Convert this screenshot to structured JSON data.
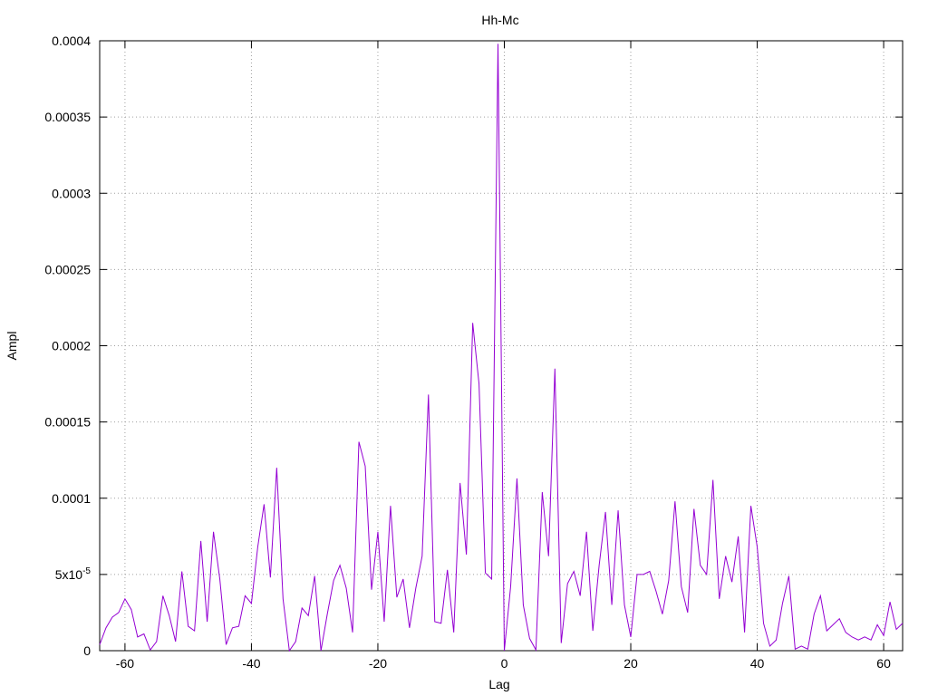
{
  "chart_data": {
    "type": "line",
    "title": "Hh-Mc",
    "xlabel": "Lag",
    "ylabel": "Ampl",
    "xlim": [
      -64,
      63
    ],
    "ylim": [
      0,
      0.0004
    ],
    "grid": true,
    "x_ticks": [
      -60,
      -40,
      -20,
      0,
      20,
      40,
      60
    ],
    "x_tick_labels": [
      "-60",
      "-40",
      "-20",
      "0",
      "20",
      "40",
      "60"
    ],
    "y_ticks": [
      0,
      5e-05,
      0.0001,
      0.00015,
      0.0002,
      0.00025,
      0.0003,
      0.00035,
      0.0004
    ],
    "y_tick_labels": [
      "0",
      "5x10-5",
      "0.0001",
      "0.00015",
      "0.0002",
      "0.00025",
      "0.0003",
      "0.00035",
      "0.0004"
    ],
    "series": [
      {
        "color": "#9400d3",
        "x": [
          -64,
          -63,
          -62,
          -61,
          -60,
          -59,
          -58,
          -57,
          -56,
          -55,
          -54,
          -53,
          -52,
          -51,
          -50,
          -49,
          -48,
          -47,
          -46,
          -45,
          -44,
          -43,
          -42,
          -41,
          -40,
          -39,
          -38,
          -37,
          -36,
          -35,
          -34,
          -33,
          -32,
          -31,
          -30,
          -29,
          -28,
          -27,
          -26,
          -25,
          -24,
          -23,
          -22,
          -21,
          -20,
          -19,
          -18,
          -17,
          -16,
          -15,
          -14,
          -13,
          -12,
          -11,
          -10,
          -9,
          -8,
          -7,
          -6,
          -5,
          -4,
          -3,
          -2,
          -1,
          0,
          1,
          2,
          3,
          4,
          5,
          6,
          7,
          8,
          9,
          10,
          11,
          12,
          13,
          14,
          15,
          16,
          17,
          18,
          19,
          20,
          21,
          22,
          23,
          24,
          25,
          26,
          27,
          28,
          29,
          30,
          31,
          32,
          33,
          34,
          35,
          36,
          37,
          38,
          39,
          40,
          41,
          42,
          43,
          44,
          45,
          46,
          47,
          48,
          49,
          50,
          51,
          52,
          53,
          54,
          55,
          56,
          57,
          58,
          59,
          60,
          61,
          62,
          63
        ],
        "values": [
          4e-06,
          1.5e-05,
          2.2e-05,
          2.5e-05,
          3.4e-05,
          2.7e-05,
          9e-06,
          1.1e-05,
          5e-07,
          6e-06,
          3.6e-05,
          2.3e-05,
          6e-06,
          5.2e-05,
          1.6e-05,
          1.3e-05,
          7.2e-05,
          1.9e-05,
          7.8e-05,
          4.7e-05,
          4e-06,
          1.5e-05,
          1.6e-05,
          3.6e-05,
          3.1e-05,
          6.8e-05,
          9.6e-05,
          4.8e-05,
          0.00012,
          3.4e-05,
          0.0,
          6e-06,
          2.8e-05,
          2.3e-05,
          4.9e-05,
          0.0,
          2.4e-05,
          4.6e-05,
          5.6e-05,
          4.1e-05,
          1.2e-05,
          0.000137,
          0.000121,
          4e-05,
          7.8e-05,
          1.9e-05,
          9.5e-05,
          3.5e-05,
          4.7e-05,
          1.5e-05,
          4.1e-05,
          6.2e-05,
          0.000168,
          1.9e-05,
          1.8e-05,
          5.3e-05,
          1.2e-05,
          0.00011,
          6.3e-05,
          0.000215,
          0.000175,
          5.1e-05,
          4.7e-05,
          0.000398,
          0.0,
          4.2e-05,
          0.000113,
          3e-05,
          8e-06,
          5e-07,
          0.000104,
          6.2e-05,
          0.000185,
          5e-06,
          4.4e-05,
          5.2e-05,
          3.6e-05,
          7.8e-05,
          1.3e-05,
          5.6e-05,
          9.1e-05,
          3e-05,
          9.2e-05,
          3e-05,
          9e-06,
          5e-05,
          5e-05,
          5.2e-05,
          3.9e-05,
          2.4e-05,
          4.6e-05,
          9.8e-05,
          4.2e-05,
          2.5e-05,
          9.3e-05,
          5.6e-05,
          5e-05,
          0.000112,
          3.4e-05,
          6.2e-05,
          4.5e-05,
          7.5e-05,
          1.2e-05,
          9.5e-05,
          6.8e-05,
          1.8e-05,
          3e-06,
          7e-06,
          3.1e-05,
          4.9e-05,
          1e-06,
          3e-06,
          1e-06,
          2.4e-05,
          3.6e-05,
          1.3e-05,
          1.7e-05,
          2.1e-05,
          1.2e-05,
          9e-06,
          7e-06,
          9e-06,
          7e-06,
          1.7e-05,
          1e-05,
          3.2e-05,
          1.4e-05,
          1.8e-05
        ]
      }
    ]
  }
}
